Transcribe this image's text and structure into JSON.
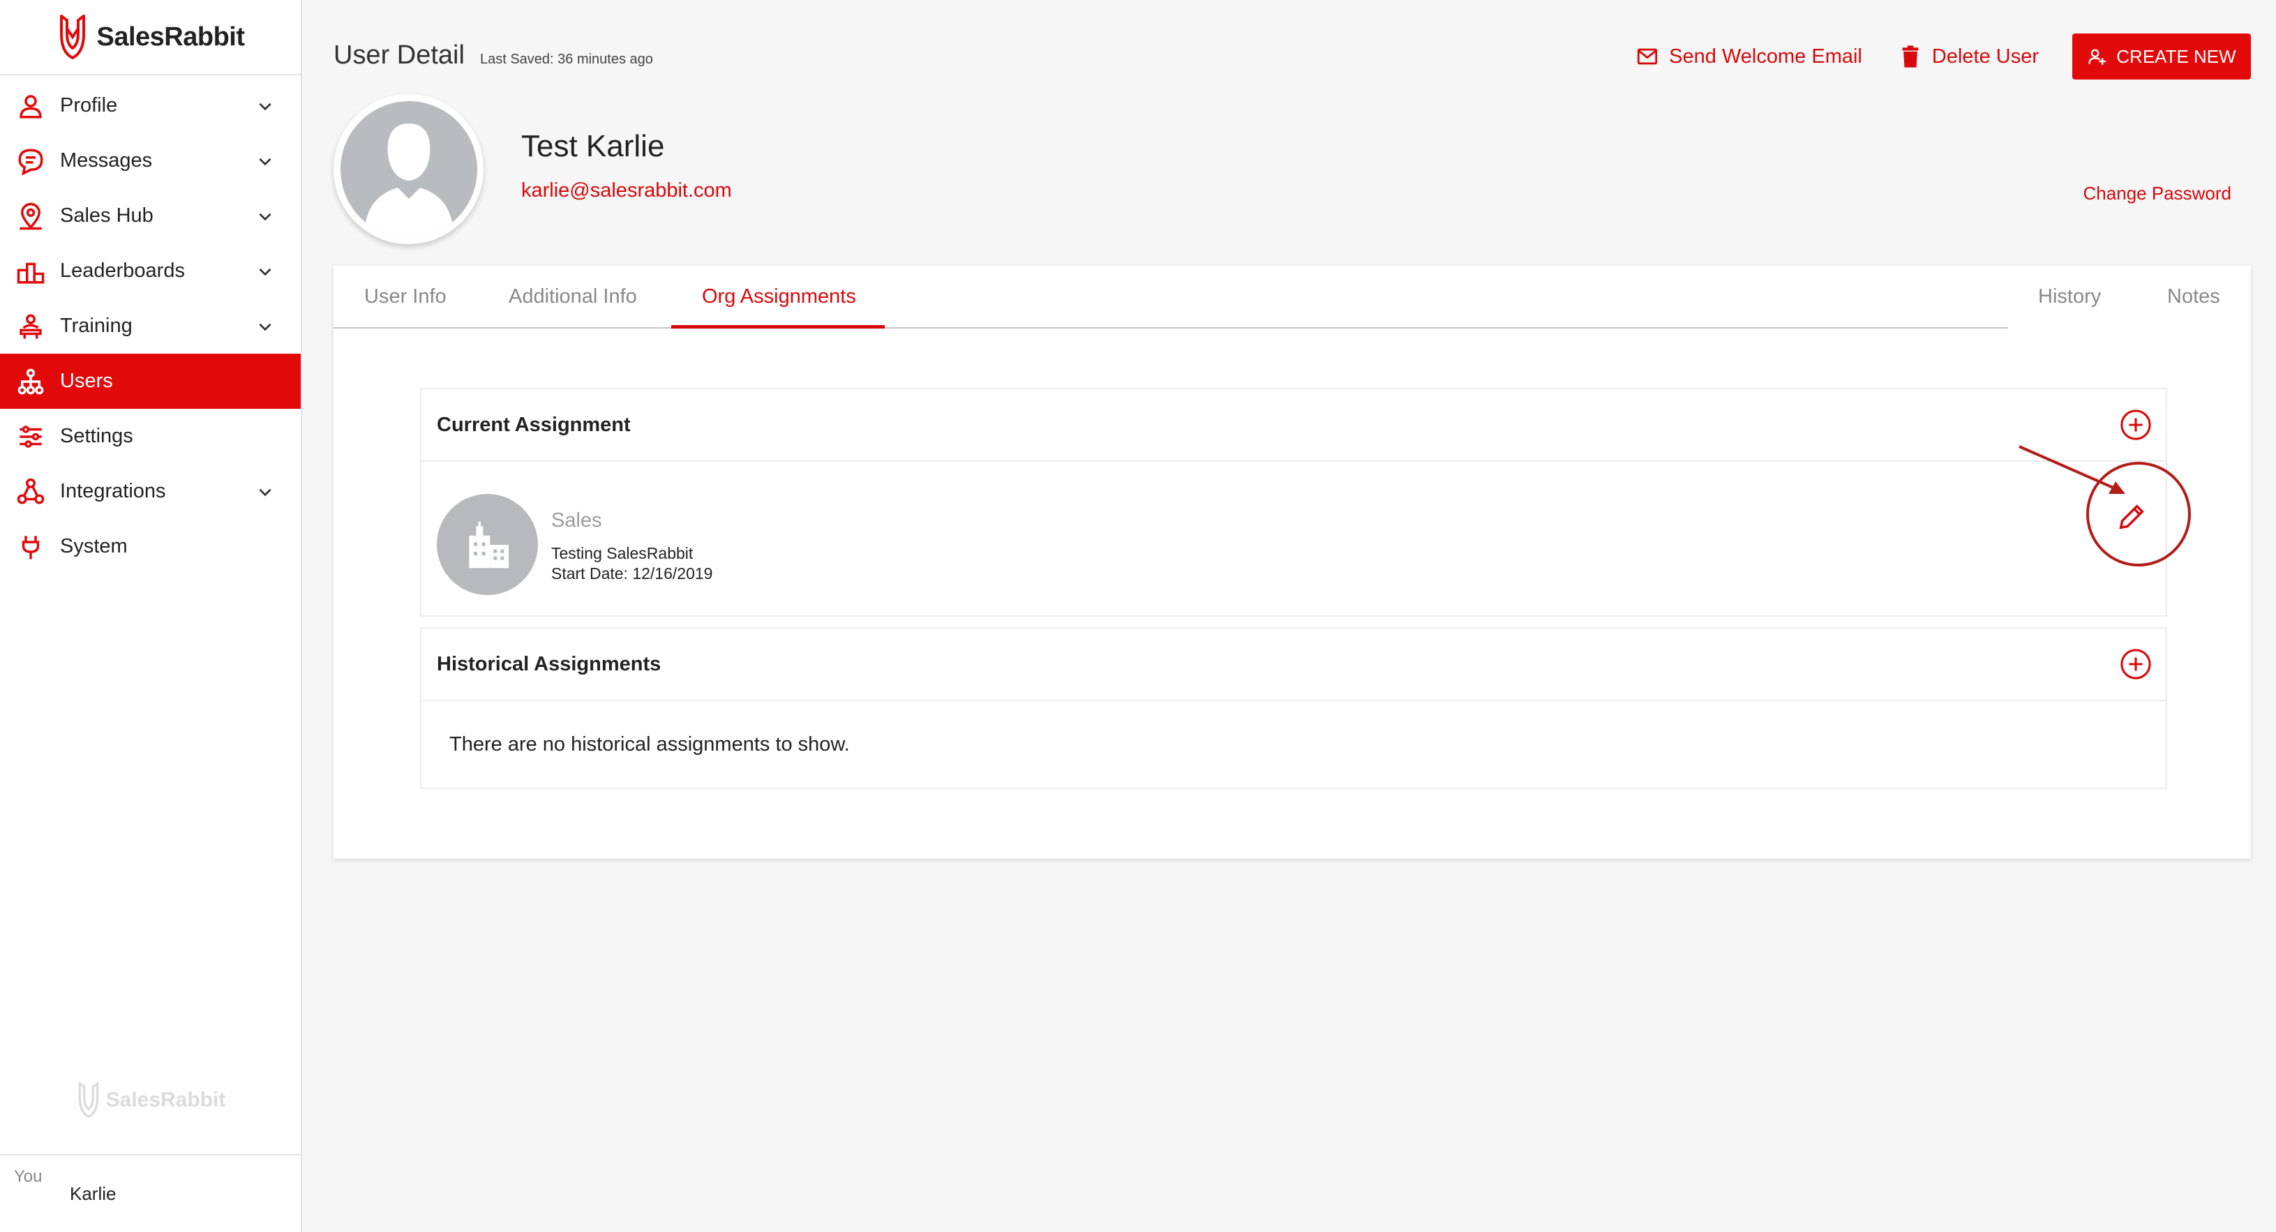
{
  "app": {
    "brand": "SalesRabbit"
  },
  "sidebar": {
    "items": [
      {
        "label": "Profile",
        "icon": "person-icon",
        "has_children": true
      },
      {
        "label": "Messages",
        "icon": "chat-icon",
        "has_children": true
      },
      {
        "label": "Sales Hub",
        "icon": "map-pin-icon",
        "has_children": true
      },
      {
        "label": "Leaderboards",
        "icon": "podium-icon",
        "has_children": true
      },
      {
        "label": "Training",
        "icon": "training-icon",
        "has_children": true
      },
      {
        "label": "Users",
        "icon": "org-chart-icon",
        "has_children": false,
        "active": true
      },
      {
        "label": "Settings",
        "icon": "sliders-icon",
        "has_children": false
      },
      {
        "label": "Integrations",
        "icon": "network-icon",
        "has_children": true
      },
      {
        "label": "System",
        "icon": "plug-icon",
        "has_children": false
      }
    ],
    "footer_user": "Karlie",
    "footer_avatar_alt": "You"
  },
  "header": {
    "title": "User Detail",
    "last_saved_label": "Last Saved:",
    "last_saved_value": "36 minutes ago",
    "send_email": "Send Welcome Email",
    "delete_user": "Delete User",
    "create_new": "CREATE NEW"
  },
  "profile": {
    "name": "Test Karlie",
    "email": "karlie@salesrabbit.com",
    "change_password": "Change Password"
  },
  "tabs": [
    "User Info",
    "Additional Info",
    "Org Assignments",
    "History",
    "Notes"
  ],
  "active_tab": "Org Assignments",
  "current_assignment": {
    "title": "Current Assignment",
    "org_name": "Sales",
    "org_parent": "Testing SalesRabbit",
    "start_date": "Start Date: 12/16/2019"
  },
  "historical": {
    "title": "Historical Assignments",
    "empty": "There are no historical assignments to show."
  },
  "colors": {
    "accent": "#e2090b",
    "text": "#222222",
    "muted": "#888888"
  }
}
